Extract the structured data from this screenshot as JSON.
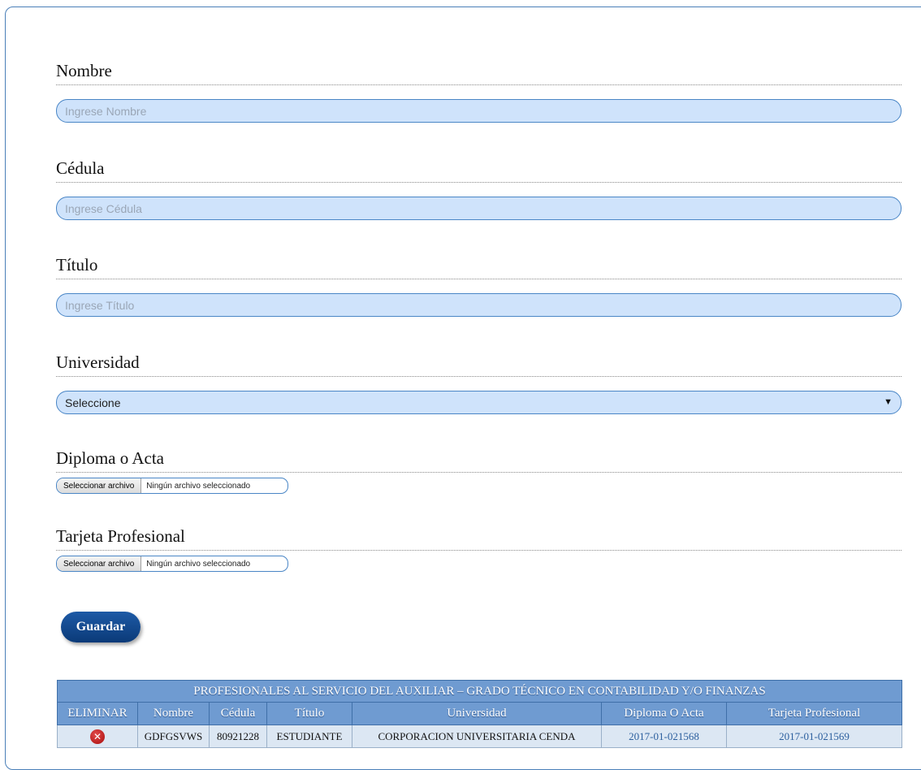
{
  "form": {
    "nombre": {
      "label": "Nombre",
      "placeholder": "Ingrese Nombre",
      "value": ""
    },
    "cedula": {
      "label": "Cédula",
      "placeholder": "Ingrese Cédula",
      "value": ""
    },
    "titulo": {
      "label": "Título",
      "placeholder": "Ingrese Título",
      "value": ""
    },
    "universidad": {
      "label": "Universidad",
      "selected": "Seleccione"
    },
    "diploma": {
      "label": "Diploma o Acta",
      "button": "Seleccionar archivo",
      "status": "Ningún archivo seleccionado"
    },
    "tarjeta": {
      "label": "Tarjeta Profesional",
      "button": "Seleccionar archivo",
      "status": "Ningún archivo seleccionado"
    },
    "save_label": "Guardar"
  },
  "table": {
    "title": "PROFESIONALES AL SERVICIO DEL AUXILIAR – GRADO TÉCNICO EN CONTABILIDAD Y/O FINANZAS",
    "headers": [
      "ELIMINAR",
      "Nombre",
      "Cédula",
      "Título",
      "Universidad",
      "Diploma O Acta",
      "Tarjeta Profesional"
    ],
    "rows": [
      {
        "delete_icon": "delete-icon",
        "nombre": "GDFGSVWS",
        "cedula": "80921228",
        "titulo": "ESTUDIANTE",
        "universidad": "CORPORACION UNIVERSITARIA CENDA",
        "diploma": "2017-01-021568",
        "tarjeta": "2017-01-021569"
      }
    ]
  },
  "colors": {
    "input_bg": "#cfe3fb",
    "input_border": "#4a86c6",
    "button_bg": "#0b3a78",
    "table_header_bg": "#6f9bd1",
    "table_row_bg": "#dce7f3",
    "link": "#2c5f9e",
    "delete": "#c01818"
  }
}
